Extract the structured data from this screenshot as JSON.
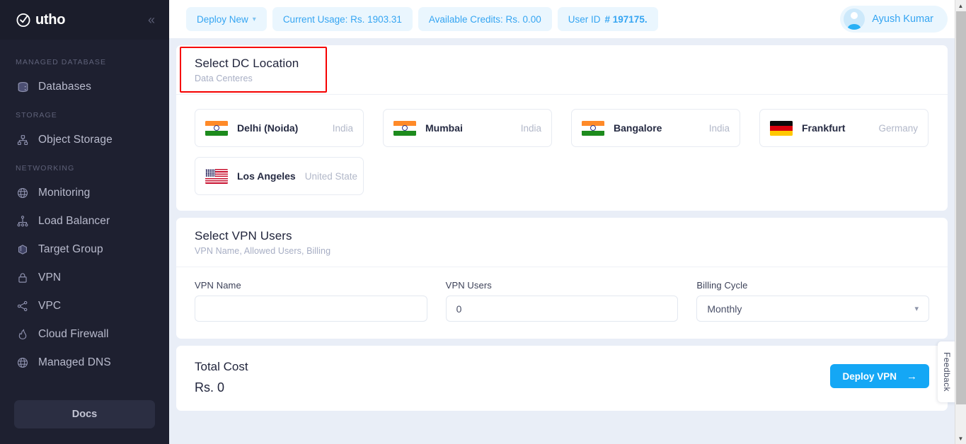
{
  "sidebar": {
    "logo_text": "utho",
    "collapse_icon": "chevron-double-left-icon",
    "sections": [
      {
        "title": "MANAGED DATABASE",
        "items": [
          {
            "label": "Databases",
            "icon": "database-icon"
          }
        ]
      },
      {
        "title": "STORAGE",
        "items": [
          {
            "label": "Object Storage",
            "icon": "object-storage-icon"
          }
        ]
      },
      {
        "title": "NETWORKING",
        "items": [
          {
            "label": "Monitoring",
            "icon": "globe-icon"
          },
          {
            "label": "Load Balancer",
            "icon": "load-balancer-icon"
          },
          {
            "label": "Target Group",
            "icon": "cube-icon"
          },
          {
            "label": "VPN",
            "icon": "lock-icon"
          },
          {
            "label": "VPC",
            "icon": "share-nodes-icon"
          },
          {
            "label": "Cloud Firewall",
            "icon": "fire-icon"
          },
          {
            "label": "Managed DNS",
            "icon": "globe-icon"
          }
        ]
      }
    ],
    "docs_label": "Docs"
  },
  "topbar": {
    "deploy_new_label": "Deploy New",
    "deploy_new_caret": "chevron-down-icon",
    "current_usage_label": "Current Usage: Rs. 1903.31",
    "available_credits_label": "Available Credits: Rs. 0.00",
    "user_id_prefix": "User ID ",
    "user_id_value": "# 197175.",
    "user_name": "Ayush Kumar",
    "avatar_icon": "user-avatar-icon",
    "accent_color": "#35a5f2",
    "pill_bg_color": "#eaf6fe"
  },
  "dc_section": {
    "title": "Select DC Location",
    "subtitle": "Data Centeres",
    "highlight_color": "#f60000",
    "locations": [
      {
        "name": "Delhi (Noida)",
        "country": "India",
        "flag": "flag-india-icon"
      },
      {
        "name": "Mumbai",
        "country": "India",
        "flag": "flag-india-icon"
      },
      {
        "name": "Bangalore",
        "country": "India",
        "flag": "flag-india-icon"
      },
      {
        "name": "Frankfurt",
        "country": "Germany",
        "flag": "flag-germany-icon"
      },
      {
        "name": "Los Angeles",
        "country": "United State",
        "flag": "flag-usa-icon"
      }
    ]
  },
  "vpn_section": {
    "title": "Select VPN Users",
    "subtitle": "VPN Name, Allowed Users, Billing",
    "vpn_name_label": "VPN Name",
    "vpn_name_value": "",
    "vpn_name_placeholder": "",
    "vpn_users_label": "VPN Users",
    "vpn_users_value": "0",
    "billing_cycle_label": "Billing Cycle",
    "billing_cycle_value": "Monthly",
    "billing_cycle_caret": "chevron-down-icon"
  },
  "cost_section": {
    "title": "Total Cost",
    "value": "Rs. 0",
    "deploy_button_label": "Deploy VPN",
    "deploy_button_icon": "arrow-right-icon",
    "deploy_button_color": "#14a7f5"
  },
  "feedback": {
    "label": "Feedback"
  }
}
